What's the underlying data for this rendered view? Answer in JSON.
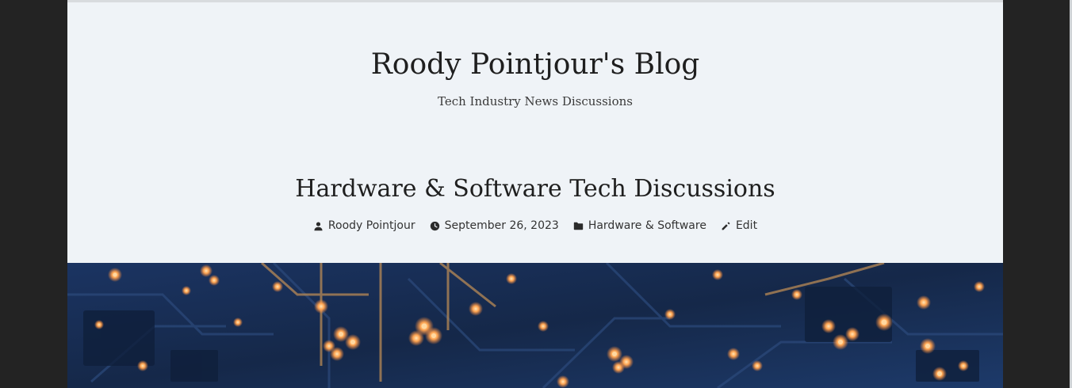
{
  "site": {
    "title": "Roody Pointjour's Blog",
    "tagline": "Tech Industry News Discussions"
  },
  "post": {
    "title": "Hardware & Software Tech Discussions",
    "meta": {
      "author": "Roody Pointjour",
      "date": "September 26, 2023",
      "category": "Hardware & Software",
      "edit_label": "Edit"
    }
  },
  "icons": {
    "author": "person-icon",
    "date": "clock-icon",
    "category": "folder-icon",
    "edit": "pencil-icon"
  },
  "colors": {
    "page_background": "#eff3f7",
    "outer_background": "#232323",
    "hero_base": "#1a2f57",
    "hero_glow": "#ff9a4a"
  }
}
